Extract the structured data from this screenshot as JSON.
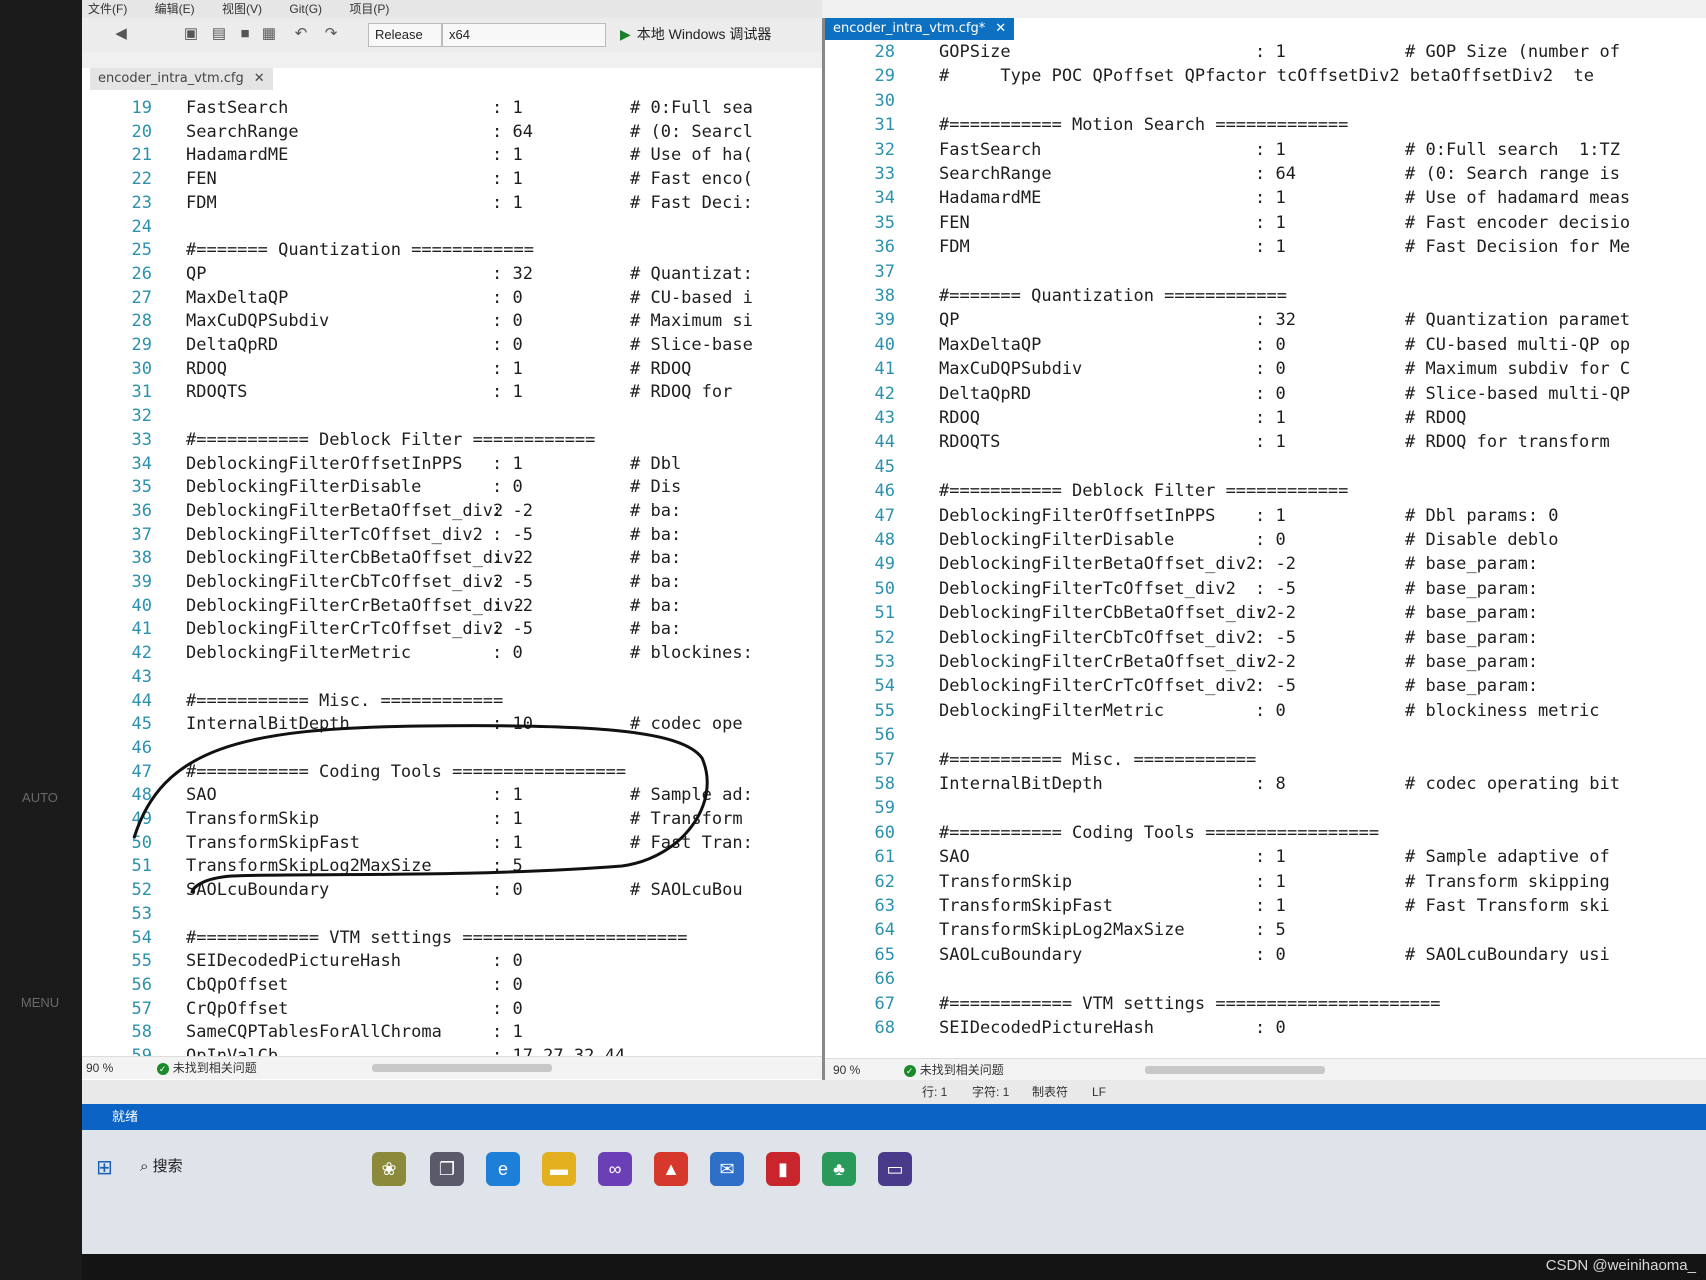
{
  "bezel": {
    "labels": [
      "AUTO",
      "MENU"
    ]
  },
  "menu": [
    "文件(F)",
    "编辑(E)",
    "视图(V)",
    "Git(G)",
    "项目(P)"
  ],
  "toolbar": {
    "config": "Release",
    "platform": "x64",
    "run_label": "本地 Windows 调试器"
  },
  "left_pane": {
    "tab": "encoder_intra_vtm.cfg",
    "zoom": "90 %",
    "status": "未找到相关问题",
    "lines": [
      {
        "n": "19",
        "k": "FastSearch",
        "v": ": 1",
        "c": "# 0:Full sea"
      },
      {
        "n": "20",
        "k": "SearchRange",
        "v": ": 64",
        "c": "# (0: Searcl"
      },
      {
        "n": "21",
        "k": "HadamardME",
        "v": ": 1",
        "c": "# Use of ha("
      },
      {
        "n": "22",
        "k": "FEN",
        "v": ": 1",
        "c": "# Fast enco("
      },
      {
        "n": "23",
        "k": "FDM",
        "v": ": 1",
        "c": "# Fast Deci:"
      },
      {
        "n": "24",
        "k": "",
        "v": "",
        "c": ""
      },
      {
        "n": "25",
        "k": "#======= Quantization ============",
        "v": "",
        "c": ""
      },
      {
        "n": "26",
        "k": "QP",
        "v": ": 32",
        "c": "# Quantizat:"
      },
      {
        "n": "27",
        "k": "MaxDeltaQP",
        "v": ": 0",
        "c": "# CU-based i"
      },
      {
        "n": "28",
        "k": "MaxCuDQPSubdiv",
        "v": ": 0",
        "c": "# Maximum si"
      },
      {
        "n": "29",
        "k": "DeltaQpRD",
        "v": ": 0",
        "c": "# Slice-base"
      },
      {
        "n": "30",
        "k": "RDOQ",
        "v": ": 1",
        "c": "# RDOQ"
      },
      {
        "n": "31",
        "k": "RDOQTS",
        "v": ": 1",
        "c": "# RDOQ for"
      },
      {
        "n": "32",
        "k": "",
        "v": "",
        "c": ""
      },
      {
        "n": "33",
        "k": "#=========== Deblock Filter ============",
        "v": "",
        "c": ""
      },
      {
        "n": "34",
        "k": "DeblockingFilterOffsetInPPS",
        "v": ": 1",
        "c": "# Dbl"
      },
      {
        "n": "35",
        "k": "DeblockingFilterDisable",
        "v": ": 0",
        "c": "# Dis"
      },
      {
        "n": "36",
        "k": "DeblockingFilterBetaOffset_div2",
        "v": ": -2",
        "c": "# ba:"
      },
      {
        "n": "37",
        "k": "DeblockingFilterTcOffset_div2",
        "v": ": -5",
        "c": "# ba:"
      },
      {
        "n": "38",
        "k": "DeblockingFilterCbBetaOffset_div2",
        "v": ": -2",
        "c": "# ba:"
      },
      {
        "n": "39",
        "k": "DeblockingFilterCbTcOffset_div2",
        "v": ": -5",
        "c": "# ba:"
      },
      {
        "n": "40",
        "k": "DeblockingFilterCrBetaOffset_div2",
        "v": ": -2",
        "c": "# ba:"
      },
      {
        "n": "41",
        "k": "DeblockingFilterCrTcOffset_div2",
        "v": ": -5",
        "c": "# ba:"
      },
      {
        "n": "42",
        "k": "DeblockingFilterMetric",
        "v": ": 0",
        "c": "# blockines:"
      },
      {
        "n": "43",
        "k": "",
        "v": "",
        "c": ""
      },
      {
        "n": "44",
        "k": "#=========== Misc. ============",
        "v": "",
        "c": ""
      },
      {
        "n": "45",
        "k": "InternalBitDepth",
        "v": ": 10",
        "c": "# codec ope"
      },
      {
        "n": "46",
        "k": "",
        "v": "",
        "c": ""
      },
      {
        "n": "47",
        "k": "#=========== Coding Tools =================",
        "v": "",
        "c": ""
      },
      {
        "n": "48",
        "k": "SAO",
        "v": ": 1",
        "c": "# Sample ad:"
      },
      {
        "n": "49",
        "k": "TransformSkip",
        "v": ": 1",
        "c": "# Transform"
      },
      {
        "n": "50",
        "k": "TransformSkipFast",
        "v": ": 1",
        "c": "# Fast Tran:"
      },
      {
        "n": "51",
        "k": "TransformSkipLog2MaxSize",
        "v": ": 5",
        "c": ""
      },
      {
        "n": "52",
        "k": "SAOLcuBoundary",
        "v": ": 0",
        "c": "# SAOLcuBou"
      },
      {
        "n": "53",
        "k": "",
        "v": "",
        "c": ""
      },
      {
        "n": "54",
        "k": "#============ VTM settings ======================",
        "v": "",
        "c": ""
      },
      {
        "n": "55",
        "k": "SEIDecodedPictureHash",
        "v": ": 0",
        "c": ""
      },
      {
        "n": "56",
        "k": "CbQpOffset",
        "v": ": 0",
        "c": ""
      },
      {
        "n": "57",
        "k": "CrQpOffset",
        "v": ": 0",
        "c": ""
      },
      {
        "n": "58",
        "k": "SameCQPTablesForAllChroma",
        "v": ": 1",
        "c": ""
      },
      {
        "n": "59",
        "k": "QpInValCb",
        "v": ": 17 27 32 44",
        "c": ""
      }
    ]
  },
  "right_pane": {
    "tab": "encoder_intra_vtm.cfg*",
    "zoom": "90 %",
    "status": "未找到相关问题",
    "lines": [
      {
        "n": "28",
        "k": "GOPSize",
        "v": ": 1",
        "c": "# GOP Size (number of"
      },
      {
        "n": "29",
        "k": "#     Type POC QPoffset QPfactor tcOffsetDiv2 betaOffsetDiv2  te",
        "v": "",
        "c": ""
      },
      {
        "n": "30",
        "k": "",
        "v": "",
        "c": ""
      },
      {
        "n": "31",
        "k": "#=========== Motion Search =============",
        "v": "",
        "c": ""
      },
      {
        "n": "32",
        "k": "FastSearch",
        "v": ": 1",
        "c": "# 0:Full search  1:TZ"
      },
      {
        "n": "33",
        "k": "SearchRange",
        "v": ": 64",
        "c": "# (0: Search range is"
      },
      {
        "n": "34",
        "k": "HadamardME",
        "v": ": 1",
        "c": "# Use of hadamard meas"
      },
      {
        "n": "35",
        "k": "FEN",
        "v": ": 1",
        "c": "# Fast encoder decisio"
      },
      {
        "n": "36",
        "k": "FDM",
        "v": ": 1",
        "c": "# Fast Decision for Me"
      },
      {
        "n": "37",
        "k": "",
        "v": "",
        "c": ""
      },
      {
        "n": "38",
        "k": "#======= Quantization ============",
        "v": "",
        "c": ""
      },
      {
        "n": "39",
        "k": "QP",
        "v": ": 32",
        "c": "# Quantization paramet"
      },
      {
        "n": "40",
        "k": "MaxDeltaQP",
        "v": ": 0",
        "c": "# CU-based multi-QP op"
      },
      {
        "n": "41",
        "k": "MaxCuDQPSubdiv",
        "v": ": 0",
        "c": "# Maximum subdiv for C"
      },
      {
        "n": "42",
        "k": "DeltaQpRD",
        "v": ": 0",
        "c": "# Slice-based multi-QP"
      },
      {
        "n": "43",
        "k": "RDOQ",
        "v": ": 1",
        "c": "# RDOQ"
      },
      {
        "n": "44",
        "k": "RDOQTS",
        "v": ": 1",
        "c": "# RDOQ for transform"
      },
      {
        "n": "45",
        "k": "",
        "v": "",
        "c": ""
      },
      {
        "n": "46",
        "k": "#=========== Deblock Filter ============",
        "v": "",
        "c": ""
      },
      {
        "n": "47",
        "k": "DeblockingFilterOffsetInPPS",
        "v": ": 1",
        "c": "# Dbl params: 0"
      },
      {
        "n": "48",
        "k": "DeblockingFilterDisable",
        "v": ": 0",
        "c": "# Disable deblo"
      },
      {
        "n": "49",
        "k": "DeblockingFilterBetaOffset_div2",
        "v": ": -2",
        "c": "# base_param:"
      },
      {
        "n": "50",
        "k": "DeblockingFilterTcOffset_div2",
        "v": ": -5",
        "c": "# base_param:"
      },
      {
        "n": "51",
        "k": "DeblockingFilterCbBetaOffset_div2",
        "v": ": -2",
        "c": "# base_param:"
      },
      {
        "n": "52",
        "k": "DeblockingFilterCbTcOffset_div2",
        "v": ": -5",
        "c": "# base_param:"
      },
      {
        "n": "53",
        "k": "DeblockingFilterCrBetaOffset_div2",
        "v": ": -2",
        "c": "# base_param:"
      },
      {
        "n": "54",
        "k": "DeblockingFilterCrTcOffset_div2",
        "v": ": -5",
        "c": "# base_param:"
      },
      {
        "n": "55",
        "k": "DeblockingFilterMetric",
        "v": ": 0",
        "c": "# blockiness metric"
      },
      {
        "n": "56",
        "k": "",
        "v": "",
        "c": ""
      },
      {
        "n": "57",
        "k": "#=========== Misc. ============",
        "v": "",
        "c": ""
      },
      {
        "n": "58",
        "k": "InternalBitDepth",
        "v": ": 8",
        "c": "# codec operating bit"
      },
      {
        "n": "59",
        "k": "",
        "v": "",
        "c": ""
      },
      {
        "n": "60",
        "k": "#=========== Coding Tools =================",
        "v": "",
        "c": ""
      },
      {
        "n": "61",
        "k": "SAO",
        "v": ": 1",
        "c": "# Sample adaptive of"
      },
      {
        "n": "62",
        "k": "TransformSkip",
        "v": ": 1",
        "c": "# Transform skipping"
      },
      {
        "n": "63",
        "k": "TransformSkipFast",
        "v": ": 1",
        "c": "# Fast Transform ski"
      },
      {
        "n": "64",
        "k": "TransformSkipLog2MaxSize",
        "v": ": 5",
        "c": ""
      },
      {
        "n": "65",
        "k": "SAOLcuBoundary",
        "v": ": 0",
        "c": "# SAOLcuBoundary usi"
      },
      {
        "n": "66",
        "k": "",
        "v": "",
        "c": ""
      },
      {
        "n": "67",
        "k": "#============ VTM settings ======================",
        "v": "",
        "c": ""
      },
      {
        "n": "68",
        "k": "SEIDecodedPictureHash",
        "v": ": 0",
        "c": ""
      }
    ]
  },
  "infobar": {
    "line": "行: 1",
    "col": "字符: 1",
    "tabs": "制表符",
    "eol": "LF"
  },
  "statusbar": {
    "ready": "就绪"
  },
  "taskbar": {
    "search": "搜索"
  },
  "watermark": "CSDN @weinihaoma_",
  "colors": {
    "accent": "#0b63c5",
    "tab_active": "#0e70c0",
    "annotation": "#111111"
  }
}
